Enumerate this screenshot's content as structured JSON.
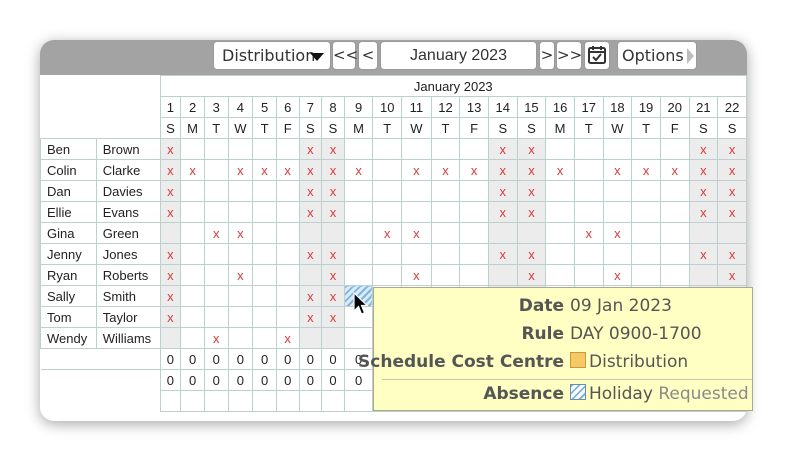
{
  "toolbar": {
    "cost_centre": "Distribution",
    "first_label": "<<",
    "prev_label": "<",
    "month": "January 2023",
    "next_label": ">",
    "last_label": ">>",
    "options_label": "Options"
  },
  "grid": {
    "month_label": "January 2023",
    "days": [
      "1",
      "2",
      "3",
      "4",
      "5",
      "6",
      "7",
      "8",
      "9",
      "10",
      "11",
      "12",
      "13",
      "14",
      "15",
      "16",
      "17",
      "18",
      "19",
      "20",
      "21",
      "22"
    ],
    "weekdays": [
      "S",
      "M",
      "T",
      "W",
      "T",
      "F",
      "S",
      "S",
      "M",
      "T",
      "W",
      "T",
      "F",
      "S",
      "S",
      "M",
      "T",
      "W",
      "T",
      "F",
      "S",
      "S"
    ],
    "employees": [
      {
        "first": "Ben",
        "last": "Brown",
        "marks": "x.....xx.....xx.....xx"
      },
      {
        "first": "Colin",
        "last": "Clarke",
        "marks": "xx.xxxxxx.xxxxxx.xxxxx"
      },
      {
        "first": "Dan",
        "last": "Davies",
        "marks": "x.....xx.....xx.....xx"
      },
      {
        "first": "Ellie",
        "last": "Evans",
        "marks": "x.....xx.....xx.....xx"
      },
      {
        "first": "Gina",
        "last": "Green",
        "marks": "..xx.....xx.....xx...."
      },
      {
        "first": "Jenny",
        "last": "Jones",
        "marks": "x.....xx.....xx.....xx"
      },
      {
        "first": "Ryan",
        "last": "Roberts",
        "marks": "x..x...x..x...x..x...x"
      },
      {
        "first": "Sally",
        "last": "Smith",
        "marks": "x.....xx.............."
      },
      {
        "first": "Tom",
        "last": "Taylor",
        "marks": "x.....xx.............."
      },
      {
        "first": "Wendy",
        "last": "Williams",
        "marks": "..x..x................"
      }
    ],
    "total_row_1": [
      "0",
      "0",
      "0",
      "0",
      "0",
      "0",
      "0",
      "0",
      "0"
    ],
    "total_row_2": [
      "0",
      "0",
      "0",
      "0",
      "0",
      "0",
      "0",
      "0",
      "0"
    ]
  },
  "tooltip": {
    "date_label": "Date",
    "date_value": "09 Jan 2023",
    "rule_label": "Rule",
    "rule_value": "DAY 0900-1700",
    "cost_centre_label": "Schedule Cost Centre",
    "cost_centre_value": "Distribution",
    "absence_label": "Absence",
    "absence_value": "Holiday",
    "absence_status": "Requested"
  },
  "colors": {
    "toolbar_bg": "#a3a3a3",
    "weekend_bg": "#ececec",
    "mark": "#d83a3a",
    "tooltip_bg": "#ffffc4",
    "cost_centre_swatch": "#f7c964"
  }
}
